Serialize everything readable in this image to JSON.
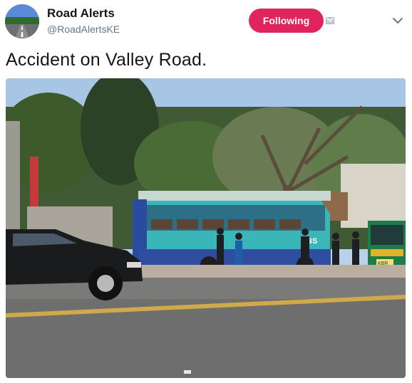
{
  "tweet": {
    "display_name": "Road Alerts",
    "handle": "@RoadAlertsKE",
    "follow_label": "Following",
    "text": "Accident on Valley Road.",
    "avatar_icon": "road-avatar-icon",
    "notification_icon": "notification-bell-icon",
    "menu_icon": "chevron-down-icon"
  },
  "colors": {
    "following_button": "#e0245e",
    "name": "#14171a",
    "handle": "#657786"
  },
  "media": {
    "bus_plate_text": "BS",
    "matatu_plate_text": "KBR"
  }
}
